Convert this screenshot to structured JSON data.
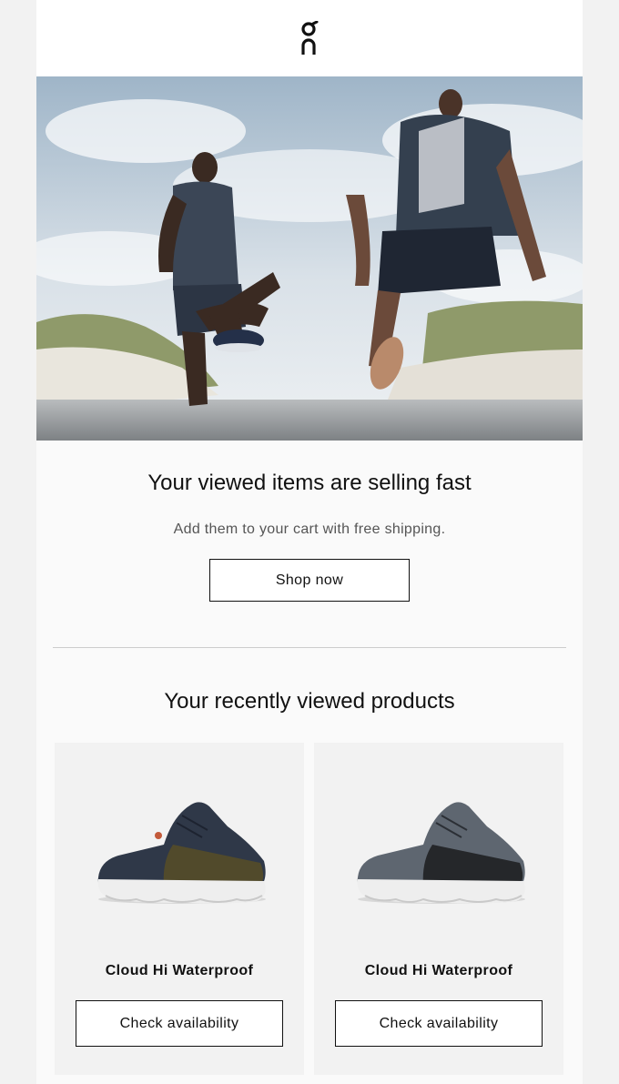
{
  "header": {
    "logo_icon": "on-brand-logo-icon"
  },
  "hero": {
    "image_icon": "runners-stretching-photo"
  },
  "intro": {
    "headline": "Your viewed items are selling fast",
    "subline": "Add them to your cart with free shipping.",
    "cta_label": "Shop now"
  },
  "recent": {
    "title": "Your recently viewed products",
    "products": [
      {
        "name": "Cloud Hi Waterproof",
        "button_label": "Check availability",
        "colorway_icon": "shoe-olive-navy-icon"
      },
      {
        "name": "Cloud Hi Waterproof",
        "button_label": "Check availability",
        "colorway_icon": "shoe-grey-black-icon"
      }
    ]
  },
  "colors": {
    "page_bg": "#f2f2f2",
    "email_bg": "#fafafa",
    "text": "#111111",
    "muted_text": "#555555",
    "border": "#111111",
    "divider": "#cccccc"
  }
}
